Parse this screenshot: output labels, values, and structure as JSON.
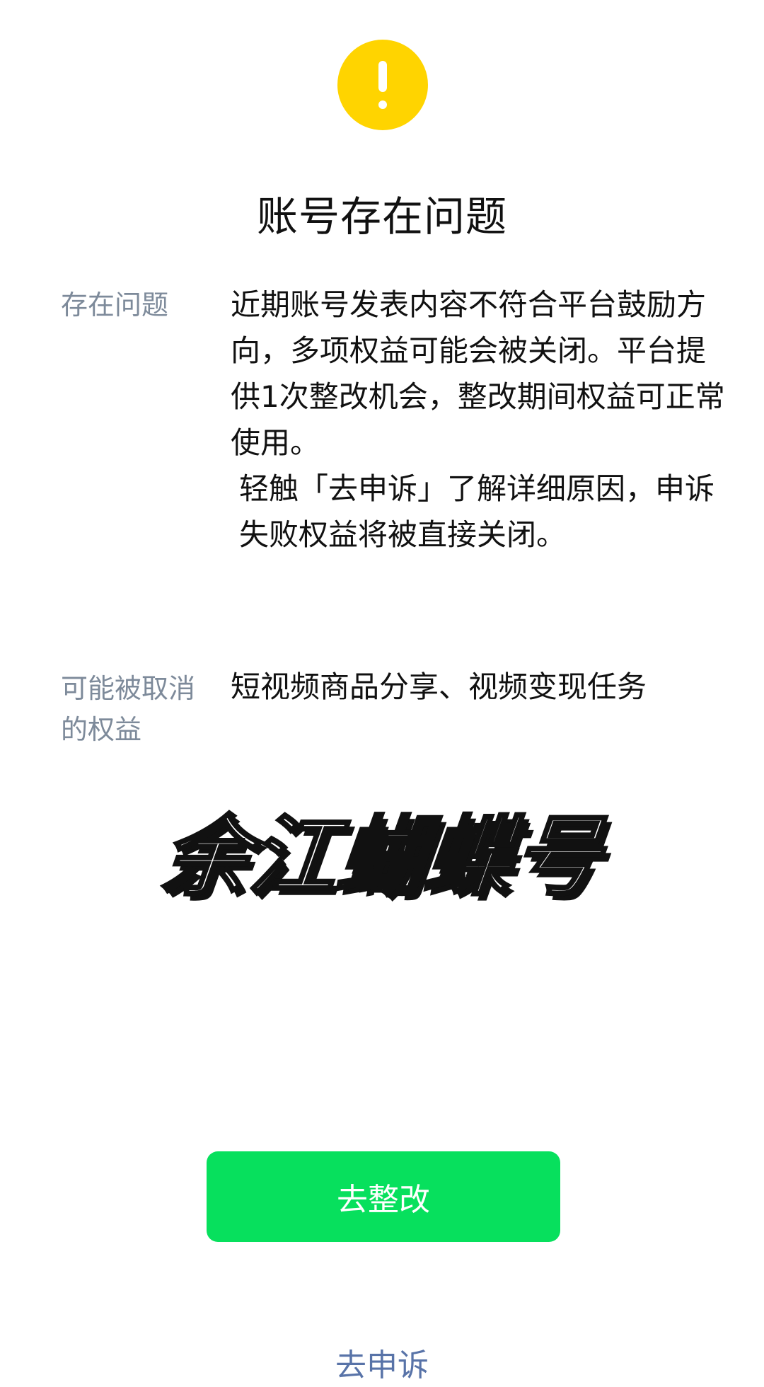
{
  "header": {
    "alert_icon": "exclamation-warning-icon",
    "alert_color": "#ffd400",
    "title": "账号存在问题"
  },
  "details": {
    "issue_label": "存在问题",
    "issue_paragraph_1": "近期账号发表内容不符合平台鼓励方向，多项权益可能会被关闭。平台提供1次整改机会，整改期间权益可正常使用。",
    "issue_paragraph_2": "轻触「去申诉」了解详细原因，申诉失败权益将被直接关闭。",
    "rights_label": "可能被取消的权益",
    "rights_value": "短视频商品分享、视频变现任务"
  },
  "watermark": {
    "text": "余江蝴蝶号"
  },
  "actions": {
    "rectify_label": "去整改",
    "rectify_color": "#07e05d",
    "appeal_label": "去申诉",
    "appeal_color": "#5873a8"
  }
}
